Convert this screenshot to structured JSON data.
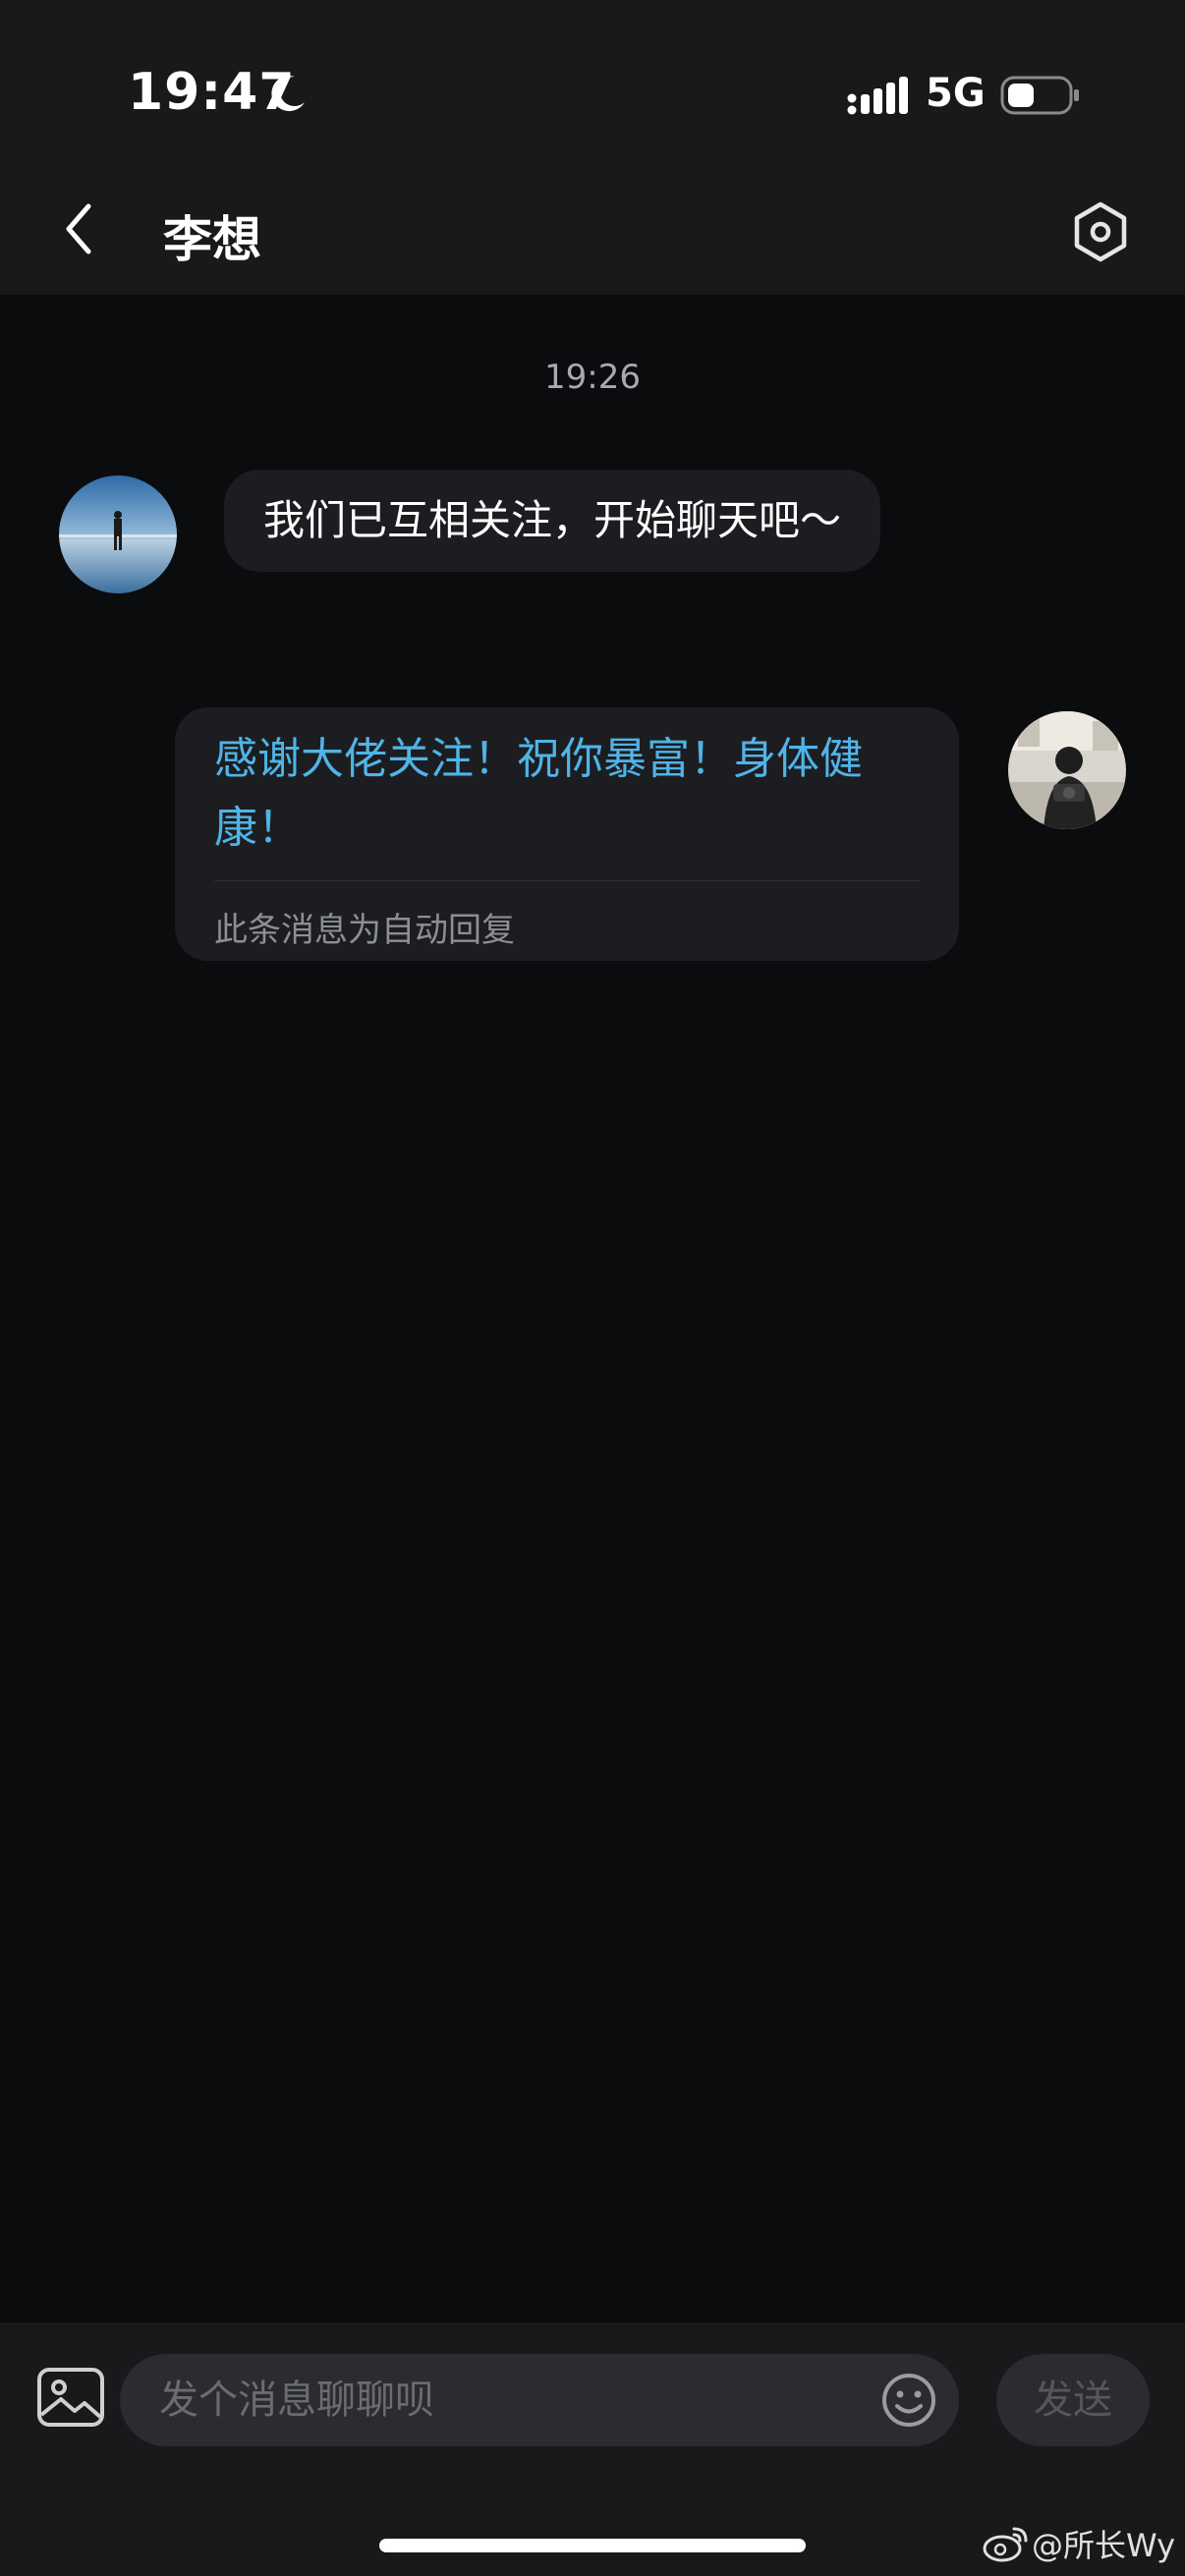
{
  "status_bar": {
    "time": "19:47",
    "network": "5G",
    "icons": [
      "moon-icon",
      "signal-icon",
      "battery-icon"
    ]
  },
  "header": {
    "title": "李想",
    "back_icon": "chevron-left-icon",
    "settings_icon": "hexagon-settings-icon"
  },
  "chat": {
    "timestamp": "19:26",
    "messages": [
      {
        "side": "left",
        "text": "我们已互相关注，开始聊天吧～"
      },
      {
        "side": "right",
        "text": "感谢大佬关注！祝你暴富！身体健康！",
        "note": "此条消息为自动回复"
      }
    ]
  },
  "input_bar": {
    "placeholder": "发个消息聊聊呗",
    "send_label": "发送",
    "image_icon": "image-icon",
    "emoji_icon": "emoji-icon"
  },
  "watermark": {
    "text": "@所长Wy",
    "icon": "weibo-icon"
  },
  "colors": {
    "background": "#0b0c0e",
    "header": "#18191b",
    "bubble": "#1c1d20",
    "auto_reply_text": "#4fb4e8",
    "input": "#2b2c30"
  }
}
